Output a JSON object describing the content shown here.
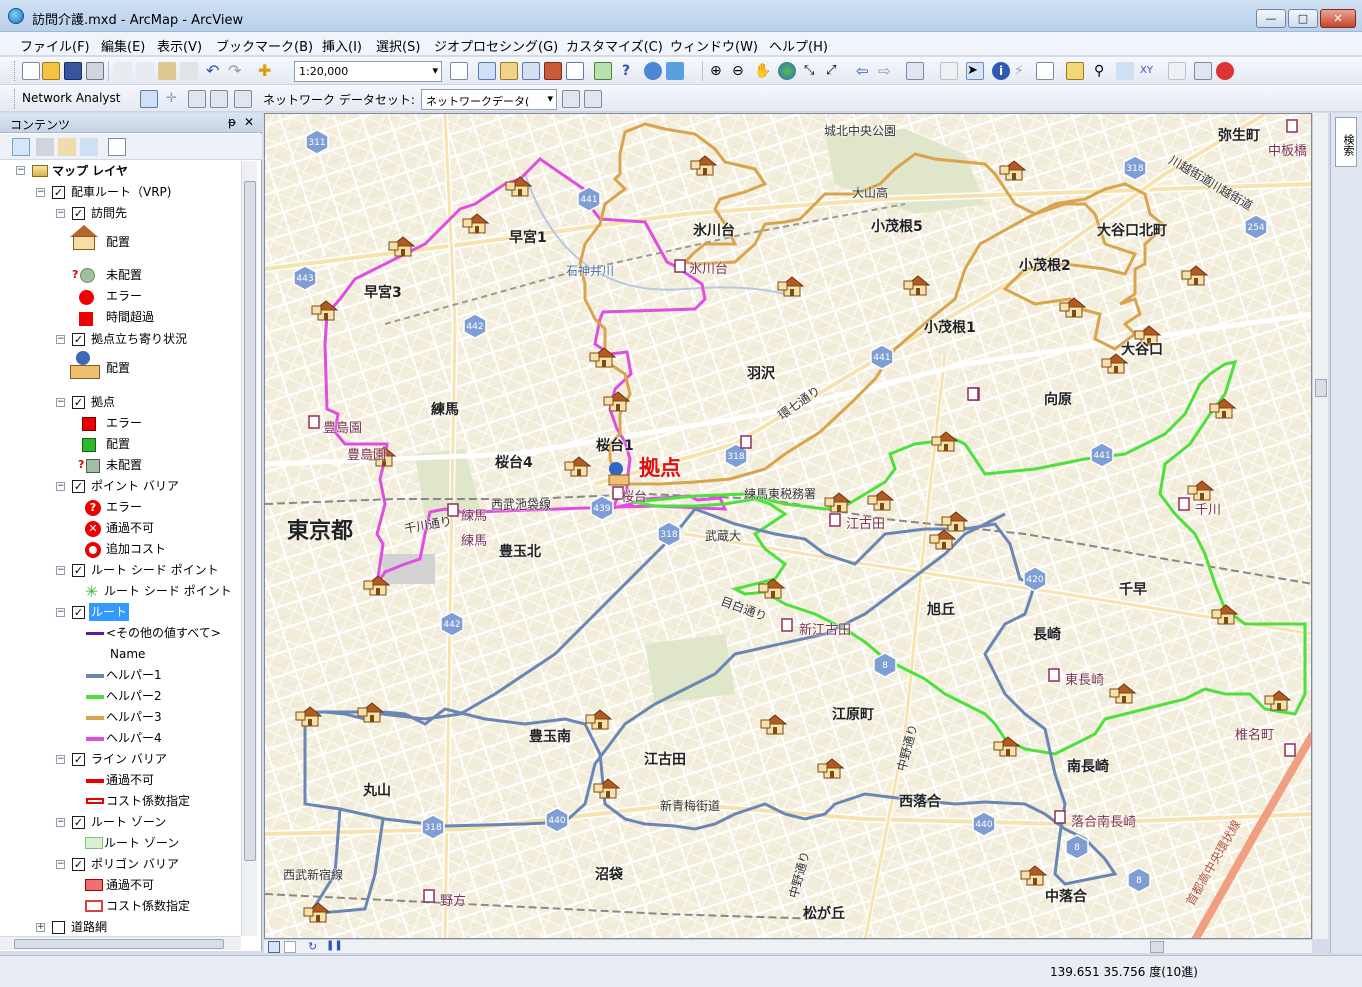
{
  "window": {
    "title": "訪問介護.mxd - ArcMap - ArcView",
    "minimize": "—",
    "maximize": "□",
    "close": "✕"
  },
  "menu": [
    "ファイル(F)",
    "編集(E)",
    "表示(V)",
    "ブックマーク(B)",
    "挿入(I)",
    "選択(S)",
    "ジオプロセシング(G)",
    "カスタマイズ(C)",
    "ウィンドウ(W)",
    "ヘルプ(H)"
  ],
  "toolbar": {
    "scale": "1:20,000",
    "network_analyst": "Network Analyst",
    "dataset_label": "ネットワーク データセット:",
    "dataset_value": "ネットワークデータ("
  },
  "toc": {
    "header": "コンテンツ",
    "pin": "ᵽ",
    "close": "✕",
    "rows": [
      {
        "text": "マップ レイヤ",
        "bold": true
      },
      {
        "text": "配車ルート（VRP)"
      },
      {
        "text": "訪問先"
      },
      {
        "text": "配置"
      },
      {
        "text": "未配置"
      },
      {
        "text": "エラー"
      },
      {
        "text": "時間超過"
      },
      {
        "text": "拠点立ち寄り状況"
      },
      {
        "text": "配置"
      },
      {
        "text": "拠点"
      },
      {
        "text": "エラー"
      },
      {
        "text": "配置"
      },
      {
        "text": "未配置"
      },
      {
        "text": "ポイント バリア"
      },
      {
        "text": "エラー"
      },
      {
        "text": "通過不可"
      },
      {
        "text": "追加コスト"
      },
      {
        "text": "ルート シード ポイント"
      },
      {
        "text": "ルート シード ポイント"
      },
      {
        "text": "ルート"
      },
      {
        "text": "<その他の値すべて>"
      },
      {
        "text": "Name"
      },
      {
        "text": "ヘルパー1"
      },
      {
        "text": "ヘルパー2"
      },
      {
        "text": "ヘルパー3"
      },
      {
        "text": "ヘルパー4"
      },
      {
        "text": "ライン バリア"
      },
      {
        "text": "通過不可"
      },
      {
        "text": "コスト係数指定"
      },
      {
        "text": "ルート ゾーン"
      },
      {
        "text": "ルート ゾーン"
      },
      {
        "text": "ポリゴン バリア"
      },
      {
        "text": "通過不可"
      },
      {
        "text": "コスト係数指定"
      },
      {
        "text": "道路網"
      }
    ]
  },
  "map": {
    "labels": {
      "joshoku": "城北中央公園",
      "yayoi": "弥生町",
      "nakaitabashi": "中板橋",
      "kawagoe1": "川越街道",
      "kawagoe2": "川越街道",
      "oyama": "大山高",
      "hikawadai": "氷川台",
      "hikawadai_st": "氷川台",
      "kotake5": "小茂根5",
      "oyaguchikita": "大谷口北町",
      "kotake2": "小茂根2",
      "hayamiya1": "早宮1",
      "shakuji": "石神井川",
      "hayamiya3": "早宮3",
      "kotake1": "小茂根1",
      "oyaguchi": "大谷口",
      "hazawa": "羽沢",
      "kannana": "環七通り",
      "mukaihara": "向原",
      "nerima": "練馬",
      "toshimaen1": "豊島園",
      "toshimaen2": "豊島園",
      "sakuradai1": "桜台1",
      "sakuradai4": "桜台4",
      "kyoten": "拠点",
      "sakuradai_st": "桜台",
      "seibu": "西武池袋線",
      "tax": "練馬東税務署",
      "ekoda": "江古田",
      "senkawa": "千川",
      "tokyo": "東京都",
      "senkawadori": "千川通り",
      "nerima_st1": "練馬",
      "nerima_st2": "練馬",
      "toyotamakita": "豊玉北",
      "musashi": "武蔵大",
      "mejiro": "目白通り",
      "shinekoda": "新江古田",
      "asahigaoka": "旭丘",
      "chihaya": "千早",
      "nagasaki": "長崎",
      "higashinagasaki": "東長崎",
      "shiinamachi": "椎名町",
      "egahara": "江原町",
      "toyotamaminami": "豊玉南",
      "ekodaarea": "江古田",
      "nakanodori1": "中野通り",
      "minaminagasaki": "南長崎",
      "maruyama": "丸山",
      "nishiochiai": "西落合",
      "shinome": "新青梅街道",
      "ochiaiminami": "落合南長崎",
      "shutoko": "首都高中央環状線",
      "nishishinjuku": "西武新宿線",
      "numabukuro": "沼袋",
      "nakanodori2": "中野通り",
      "nakaochiai": "中落合",
      "nogata": "野方",
      "matsugaoka": "松が丘"
    },
    "route_shields": [
      "311",
      "441",
      "318",
      "254",
      "443",
      "442",
      "441",
      "318",
      "441",
      "439",
      "318",
      "420",
      "442",
      "8",
      "440",
      "318",
      "440",
      "8",
      "8"
    ],
    "route_colors": {
      "helper1": "#6a86b5",
      "helper2": "#4ee03c",
      "helper3": "#d8a44e",
      "helper4": "#e04ee0",
      "other": "#5b1aa8"
    }
  },
  "status": {
    "coords": "139.651  35.756 度(10進)"
  }
}
